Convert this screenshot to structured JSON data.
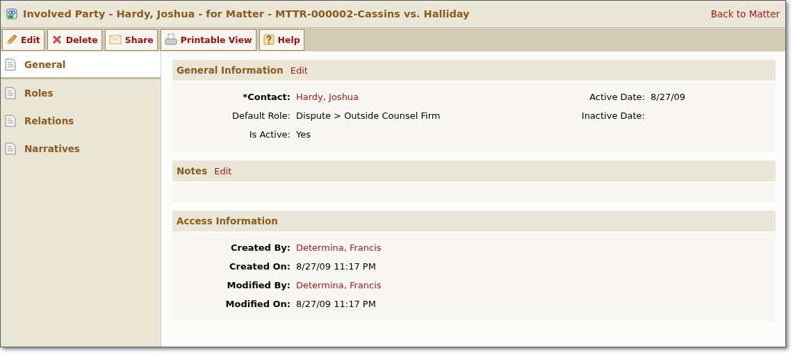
{
  "window": {
    "title": "Involved Party - Hardy, Joshua - for Matter - MTTR-000002-Cassins vs. Halliday",
    "back_link": "Back to Matter"
  },
  "toolbar": [
    {
      "kind": "edit",
      "label": "Edit"
    },
    {
      "kind": "delete",
      "label": "Delete"
    },
    {
      "kind": "share",
      "label": "Share"
    },
    {
      "kind": "print",
      "label": "Printable View"
    },
    {
      "kind": "help",
      "label": "Help"
    }
  ],
  "sidebar": {
    "items": [
      {
        "label": "General",
        "selected": true
      },
      {
        "label": "Roles",
        "selected": false
      },
      {
        "label": "Relations",
        "selected": false
      },
      {
        "label": "Narratives",
        "selected": false
      }
    ]
  },
  "sections": [
    {
      "title": "General Information",
      "edit": "Edit",
      "columns": [
        [
          {
            "label": "*Contact:",
            "bold": true,
            "value": "Hardy, Joshua",
            "kind": "link"
          },
          {
            "label": "Default Role:",
            "bold": false,
            "value": "Dispute > Outside Counsel Firm",
            "kind": "text"
          },
          {
            "label": "Is Active:",
            "bold": false,
            "value": "Yes",
            "kind": "text"
          }
        ],
        [
          {
            "label": "Active Date:",
            "bold": false,
            "value": "8/27/09",
            "kind": "text"
          },
          {
            "label": "Inactive Date:",
            "bold": false
          }
        ]
      ]
    },
    {
      "title": "Notes",
      "edit": "Edit"
    },
    {
      "title": "Access Information",
      "columns": [
        [
          {
            "label": "Created By:",
            "bold": true,
            "value": "Determina, Francis",
            "kind": "link"
          },
          {
            "label": "Created On:",
            "bold": true,
            "value": "8/27/09 11:17 PM",
            "kind": "text"
          },
          {
            "label": "Modified By:",
            "bold": true,
            "value": "Determina, Francis",
            "kind": "link"
          },
          {
            "label": "Modified On:",
            "bold": true,
            "value": "8/27/09 11:17 PM",
            "kind": "text"
          }
        ]
      ]
    }
  ]
}
